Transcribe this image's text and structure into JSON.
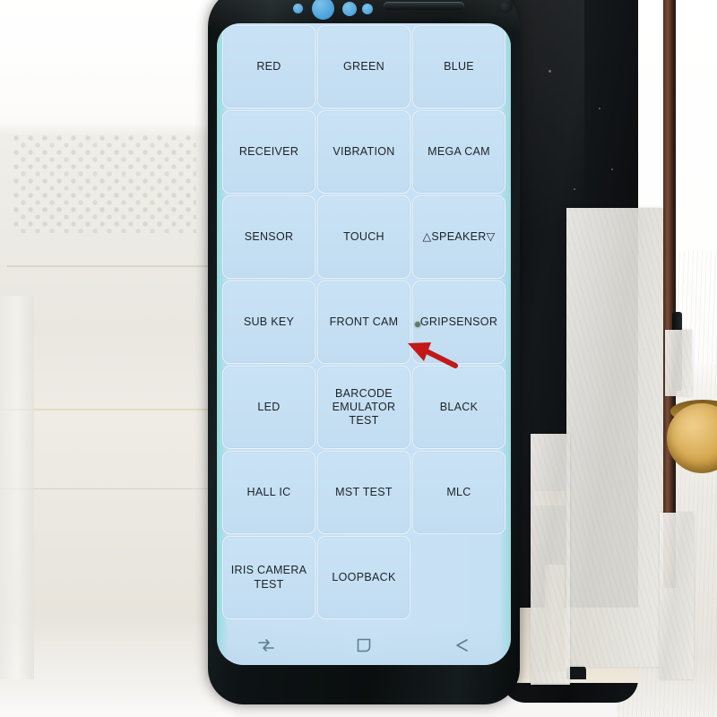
{
  "scene": {
    "description": "Samsung Galaxy S8 phone display showing factory hardware-test (secret diagnostics) menu",
    "background_material": "white styrofoam packaging foam",
    "background_device": "second dark phone panel held with masking tape"
  },
  "phone": {
    "screen_bg_color": "#c6e0f3",
    "tile_bg_color": "#c9e2f5",
    "tile_text_color": "#1d2327",
    "bezel_color": "#0d1214",
    "edge_tint_color": "#93dbdc"
  },
  "test_menu": {
    "columns": 3,
    "rows": 7,
    "tiles": [
      {
        "label": "RED",
        "name": "red"
      },
      {
        "label": "GREEN",
        "name": "green"
      },
      {
        "label": "BLUE",
        "name": "blue"
      },
      {
        "label": "RECEIVER",
        "name": "receiver"
      },
      {
        "label": "VIBRATION",
        "name": "vibration"
      },
      {
        "label": "MEGA CAM",
        "name": "mega-cam"
      },
      {
        "label": "SENSOR",
        "name": "sensor"
      },
      {
        "label": "TOUCH",
        "name": "touch"
      },
      {
        "label": "△SPEAKER▽",
        "name": "speaker"
      },
      {
        "label": "SUB KEY",
        "name": "sub-key"
      },
      {
        "label": "FRONT CAM",
        "name": "front-cam"
      },
      {
        "label": "GRIPSENSOR",
        "name": "gripsensor"
      },
      {
        "label": "LED",
        "name": "led"
      },
      {
        "label": "BARCODE EMULATOR TEST",
        "name": "barcode-emulator-test"
      },
      {
        "label": "BLACK",
        "name": "black"
      },
      {
        "label": "HALL IC",
        "name": "hall-ic"
      },
      {
        "label": "MST TEST",
        "name": "mst-test"
      },
      {
        "label": "MLC",
        "name": "mlc"
      },
      {
        "label": "IRIS CAMERA TEST",
        "name": "iris-camera-test"
      },
      {
        "label": "LOOPBACK",
        "name": "loopback"
      },
      {
        "label": "",
        "name": "empty-slot"
      }
    ]
  },
  "navbar": {
    "buttons": [
      {
        "name": "recents",
        "icon": "recents-icon"
      },
      {
        "name": "home",
        "icon": "home-square-icon"
      },
      {
        "name": "back",
        "icon": "back-arrow-icon"
      }
    ]
  },
  "annotation": {
    "arrow": {
      "icon": "pointer-arrow-icon",
      "color": "#c21818",
      "points_at": "screen-defect-dot"
    },
    "defect": {
      "name": "screen-defect-dot",
      "color": "#5d7b63"
    }
  },
  "top_bezel": {
    "elements": [
      {
        "name": "iris-sensor-small",
        "color": "#4aa3dd"
      },
      {
        "name": "front-camera",
        "color": "#3f9fdd"
      },
      {
        "name": "proximity-sensor",
        "color": "#4aa3dd"
      },
      {
        "name": "light-sensor",
        "color": "#4aa3dd"
      },
      {
        "name": "earpiece-speaker",
        "color": "#2f3a3d"
      },
      {
        "name": "ir-led",
        "color": "#2b3336"
      }
    ]
  }
}
